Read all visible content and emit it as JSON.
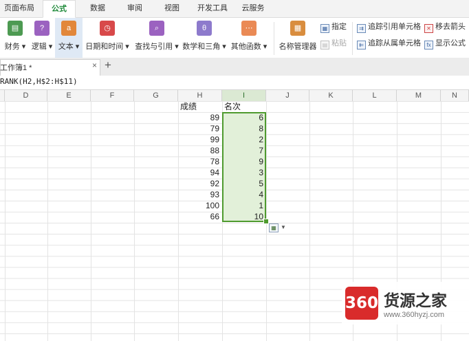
{
  "menu": {
    "tabs": [
      "页面布局",
      "公式",
      "数据",
      "审阅",
      "视图",
      "开发工具",
      "云服务"
    ],
    "active_index": 1
  },
  "ribbon": {
    "buttons": [
      {
        "label": "财务",
        "icon": "finance-icon",
        "color": "#4d9a52"
      },
      {
        "label": "逻辑",
        "icon": "logic-icon",
        "color": "#9b62c0"
      },
      {
        "label": "文本",
        "icon": "text-icon",
        "color": "#e2873a"
      },
      {
        "label": "日期和时间",
        "icon": "datetime-icon",
        "color": "#d8494a"
      },
      {
        "label": "查找与引用",
        "icon": "lookup-icon",
        "color": "#9b62c0"
      },
      {
        "label": "数学和三角",
        "icon": "math-icon",
        "color": "#8d7acc"
      },
      {
        "label": "其他函数",
        "icon": "more-functions-icon",
        "color": "#ea8a55"
      },
      {
        "label": "名称管理器",
        "icon": "name-manager-icon",
        "color": "#d98d3e"
      }
    ],
    "small_buttons": {
      "define": "指定",
      "paste": "粘贴",
      "trace_precedents": "追踪引用单元格",
      "trace_dependents": "追踪从属单元格",
      "remove_arrows": "移去箭头",
      "show_formulas": "显示公式"
    }
  },
  "doc": {
    "title": "工作簿1 *",
    "close": "×",
    "new_tab": "+"
  },
  "formula_bar": {
    "text": "RANK(H2,H$2:H$11)"
  },
  "columns": [
    "D",
    "E",
    "F",
    "G",
    "H",
    "I",
    "J",
    "K",
    "L",
    "M",
    "N"
  ],
  "selected_column": "I",
  "sheet": {
    "score_header": "成绩",
    "rank_header": "名次",
    "rows": [
      {
        "score": "89",
        "rank": "6"
      },
      {
        "score": "79",
        "rank": "8"
      },
      {
        "score": "99",
        "rank": "2"
      },
      {
        "score": "88",
        "rank": "7"
      },
      {
        "score": "78",
        "rank": "9"
      },
      {
        "score": "94",
        "rank": "3"
      },
      {
        "score": "92",
        "rank": "5"
      },
      {
        "score": "93",
        "rank": "4"
      },
      {
        "score": "100",
        "rank": "1"
      },
      {
        "score": "66",
        "rank": "10"
      }
    ]
  },
  "watermark": {
    "badge": "360",
    "name": "货源之家",
    "url": "www.360hyzj.com"
  },
  "colors": {
    "accent": "#1f8a3a",
    "selection": "#4e9a2e",
    "selection_fill": "#e2f0d9",
    "badge_red": "#d92b2b"
  }
}
